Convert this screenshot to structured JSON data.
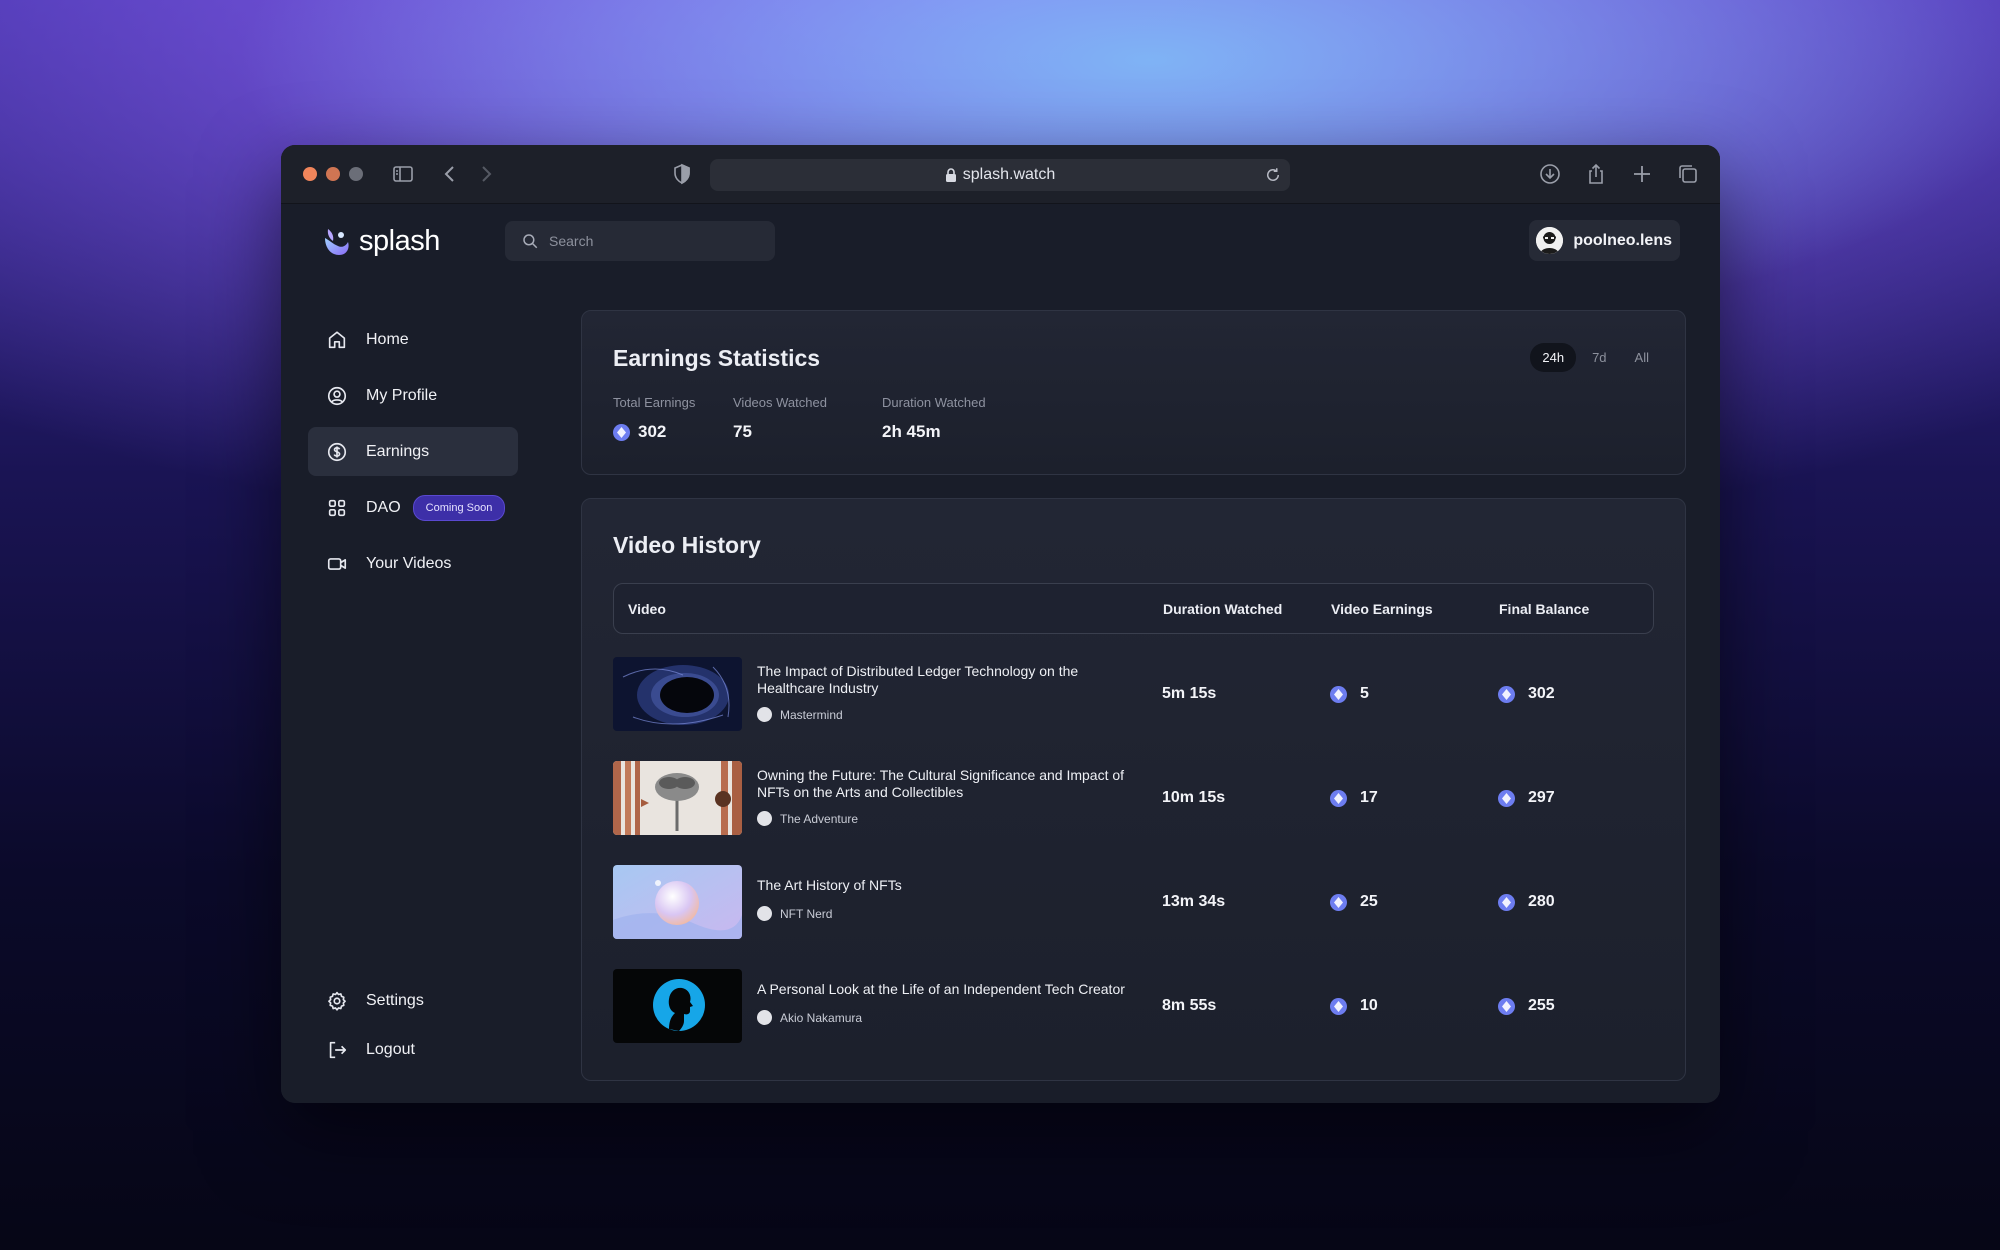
{
  "browser": {
    "url": "splash.watch"
  },
  "app": {
    "logo_text": "splash"
  },
  "search": {
    "placeholder": "Search"
  },
  "user": {
    "handle": "poolneo.lens"
  },
  "nav": {
    "items": [
      {
        "label": "Home",
        "icon": "home-icon"
      },
      {
        "label": "My Profile",
        "icon": "user-circle-icon"
      },
      {
        "label": "Earnings",
        "icon": "dollar-circle-icon",
        "active": true
      },
      {
        "label": "DAO",
        "icon": "grid-icon",
        "badge": "Coming Soon"
      },
      {
        "label": "Your Videos",
        "icon": "video-camera-icon"
      }
    ],
    "bottom": [
      {
        "label": "Settings",
        "icon": "gear-icon"
      },
      {
        "label": "Logout",
        "icon": "logout-icon"
      }
    ]
  },
  "stats": {
    "title": "Earnings Statistics",
    "ranges": [
      "24h",
      "7d",
      "All"
    ],
    "selected_range": "24h",
    "total_earnings_label": "Total Earnings",
    "total_earnings": "302",
    "videos_watched_label": "Videos Watched",
    "videos_watched": "75",
    "duration_label": "Duration Watched",
    "duration": "2h 45m"
  },
  "history": {
    "title": "Video History",
    "columns": [
      "Video",
      "Duration Watched",
      "Video Earnings",
      "Final Balance"
    ],
    "rows": [
      {
        "title": "The Impact of Distributed Ledger Technology on the Healthcare Industry",
        "author": "Mastermind",
        "duration": "5m 15s",
        "earnings": "5",
        "balance": "302"
      },
      {
        "title": "Owning the Future: The Cultural Significance and Impact of NFTs on the Arts and Collectibles",
        "author": "The Adventure",
        "duration": "10m 15s",
        "earnings": "17",
        "balance": "297"
      },
      {
        "title": "The Art History of NFTs",
        "author": "NFT Nerd",
        "duration": "13m 34s",
        "earnings": "25",
        "balance": "280"
      },
      {
        "title": "A Personal Look at the Life of an Independent Tech Creator",
        "author": "Akio Nakamura",
        "duration": "8m 55s",
        "earnings": "10",
        "balance": "255"
      }
    ]
  },
  "colors": {
    "accent": "#6d7df0",
    "badge": "#3d2fa8",
    "background": "#191d29"
  }
}
